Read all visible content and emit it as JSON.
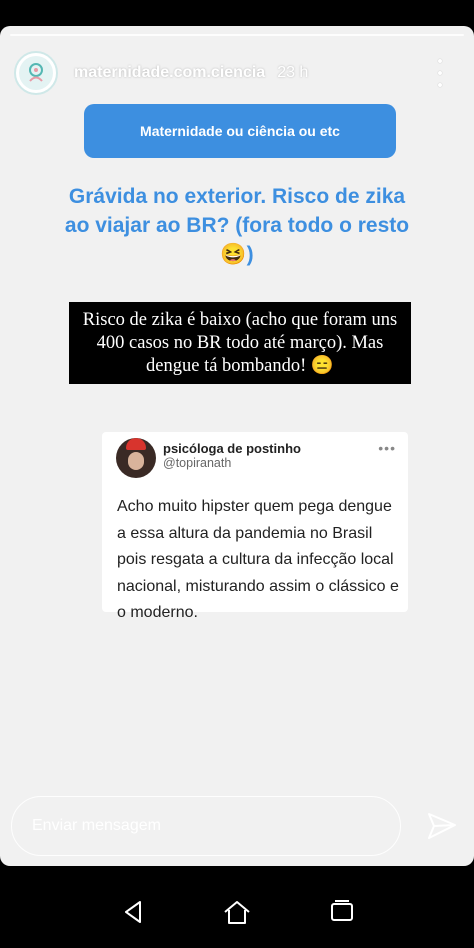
{
  "header": {
    "account_name": "maternidade.com.ciencia",
    "time_ago": "23 h",
    "avatar_icon": "maternity-logo-icon"
  },
  "question_sticker": {
    "prompt": "Maternidade ou ciência ou etc",
    "question": "Grávida no exterior. Risco de zika ao viajar ao BR? (fora todo o resto 😆)"
  },
  "answer": {
    "text": "Risco de zika é baixo (acho que foram uns 400 casos no BR todo até março). Mas dengue tá bombando! 😑"
  },
  "tweet": {
    "name": "psicóloga de postinho",
    "handle": "@topiranath",
    "body": "Acho muito hipster quem pega dengue a essa altura da pandemia no Brasil pois resgata a cultura da infecção local nacional, misturando assim o clássico e o moderno.",
    "more_icon": "ellipsis-icon"
  },
  "message_bar": {
    "placeholder": "Enviar mensagem",
    "send_icon": "send-icon"
  },
  "colors": {
    "accent": "#3d8fe0",
    "story_background": "#f1f1f1",
    "answer_background": "#000000"
  }
}
